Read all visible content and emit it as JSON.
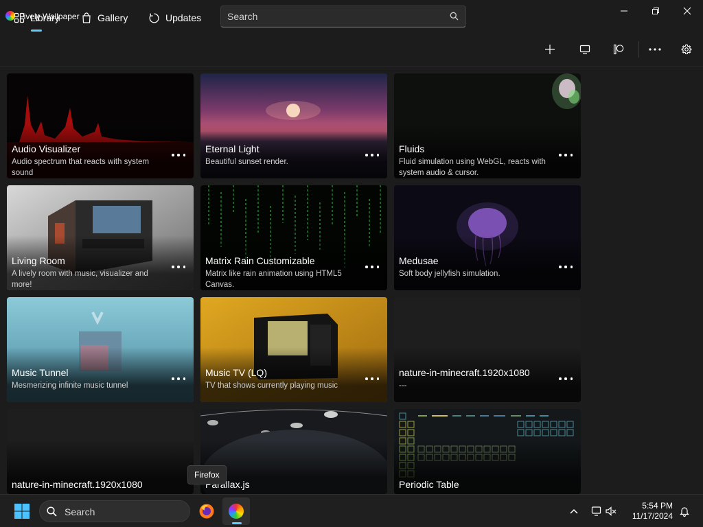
{
  "app": {
    "title": "Lively Wallpaper",
    "search_placeholder": "Search"
  },
  "nav": {
    "tabs": [
      {
        "label": "Library",
        "icon": "grid-icon",
        "selected": true
      },
      {
        "label": "Gallery",
        "icon": "shopping-bag-icon",
        "selected": false
      },
      {
        "label": "Updates",
        "icon": "refresh-icon",
        "selected": false
      }
    ],
    "tools": [
      "add-icon",
      "monitor-icon",
      "patreon-icon",
      "more-icon",
      "gear-icon"
    ]
  },
  "wallpapers": [
    {
      "title": "Audio Visualizer",
      "desc": "Audio spectrum that reacts with system sound"
    },
    {
      "title": "Eternal Light",
      "desc": "Beautiful sunset render."
    },
    {
      "title": "Fluids",
      "desc": "Fluid simulation using WebGL, reacts with system audio & cursor."
    },
    {
      "title": "Living Room",
      "desc": "A lively room with music, visualizer and more!"
    },
    {
      "title": "Matrix Rain Customizable",
      "desc": "Matrix like rain animation using HTML5 Canvas."
    },
    {
      "title": "Medusae",
      "desc": "Soft body jellyfish simulation."
    },
    {
      "title": "Music Tunnel",
      "desc": "Mesmerizing infinite music tunnel"
    },
    {
      "title": "Music TV (LQ)",
      "desc": "TV that shows currently playing music"
    },
    {
      "title": "nature-in-minecraft.1920x1080",
      "desc": "---"
    },
    {
      "title": "nature-in-minecraft.1920x1080",
      "desc": ""
    },
    {
      "title": "Parallax.js",
      "desc": ""
    },
    {
      "title": "Periodic Table",
      "desc": ""
    }
  ],
  "tooltip": {
    "text": "Firefox"
  },
  "taskbar": {
    "search_label": "Search",
    "time": "5:54 PM",
    "date": "11/17/2024"
  },
  "colors": {
    "accent": "#60cdff",
    "background": "#1c1c1c"
  }
}
